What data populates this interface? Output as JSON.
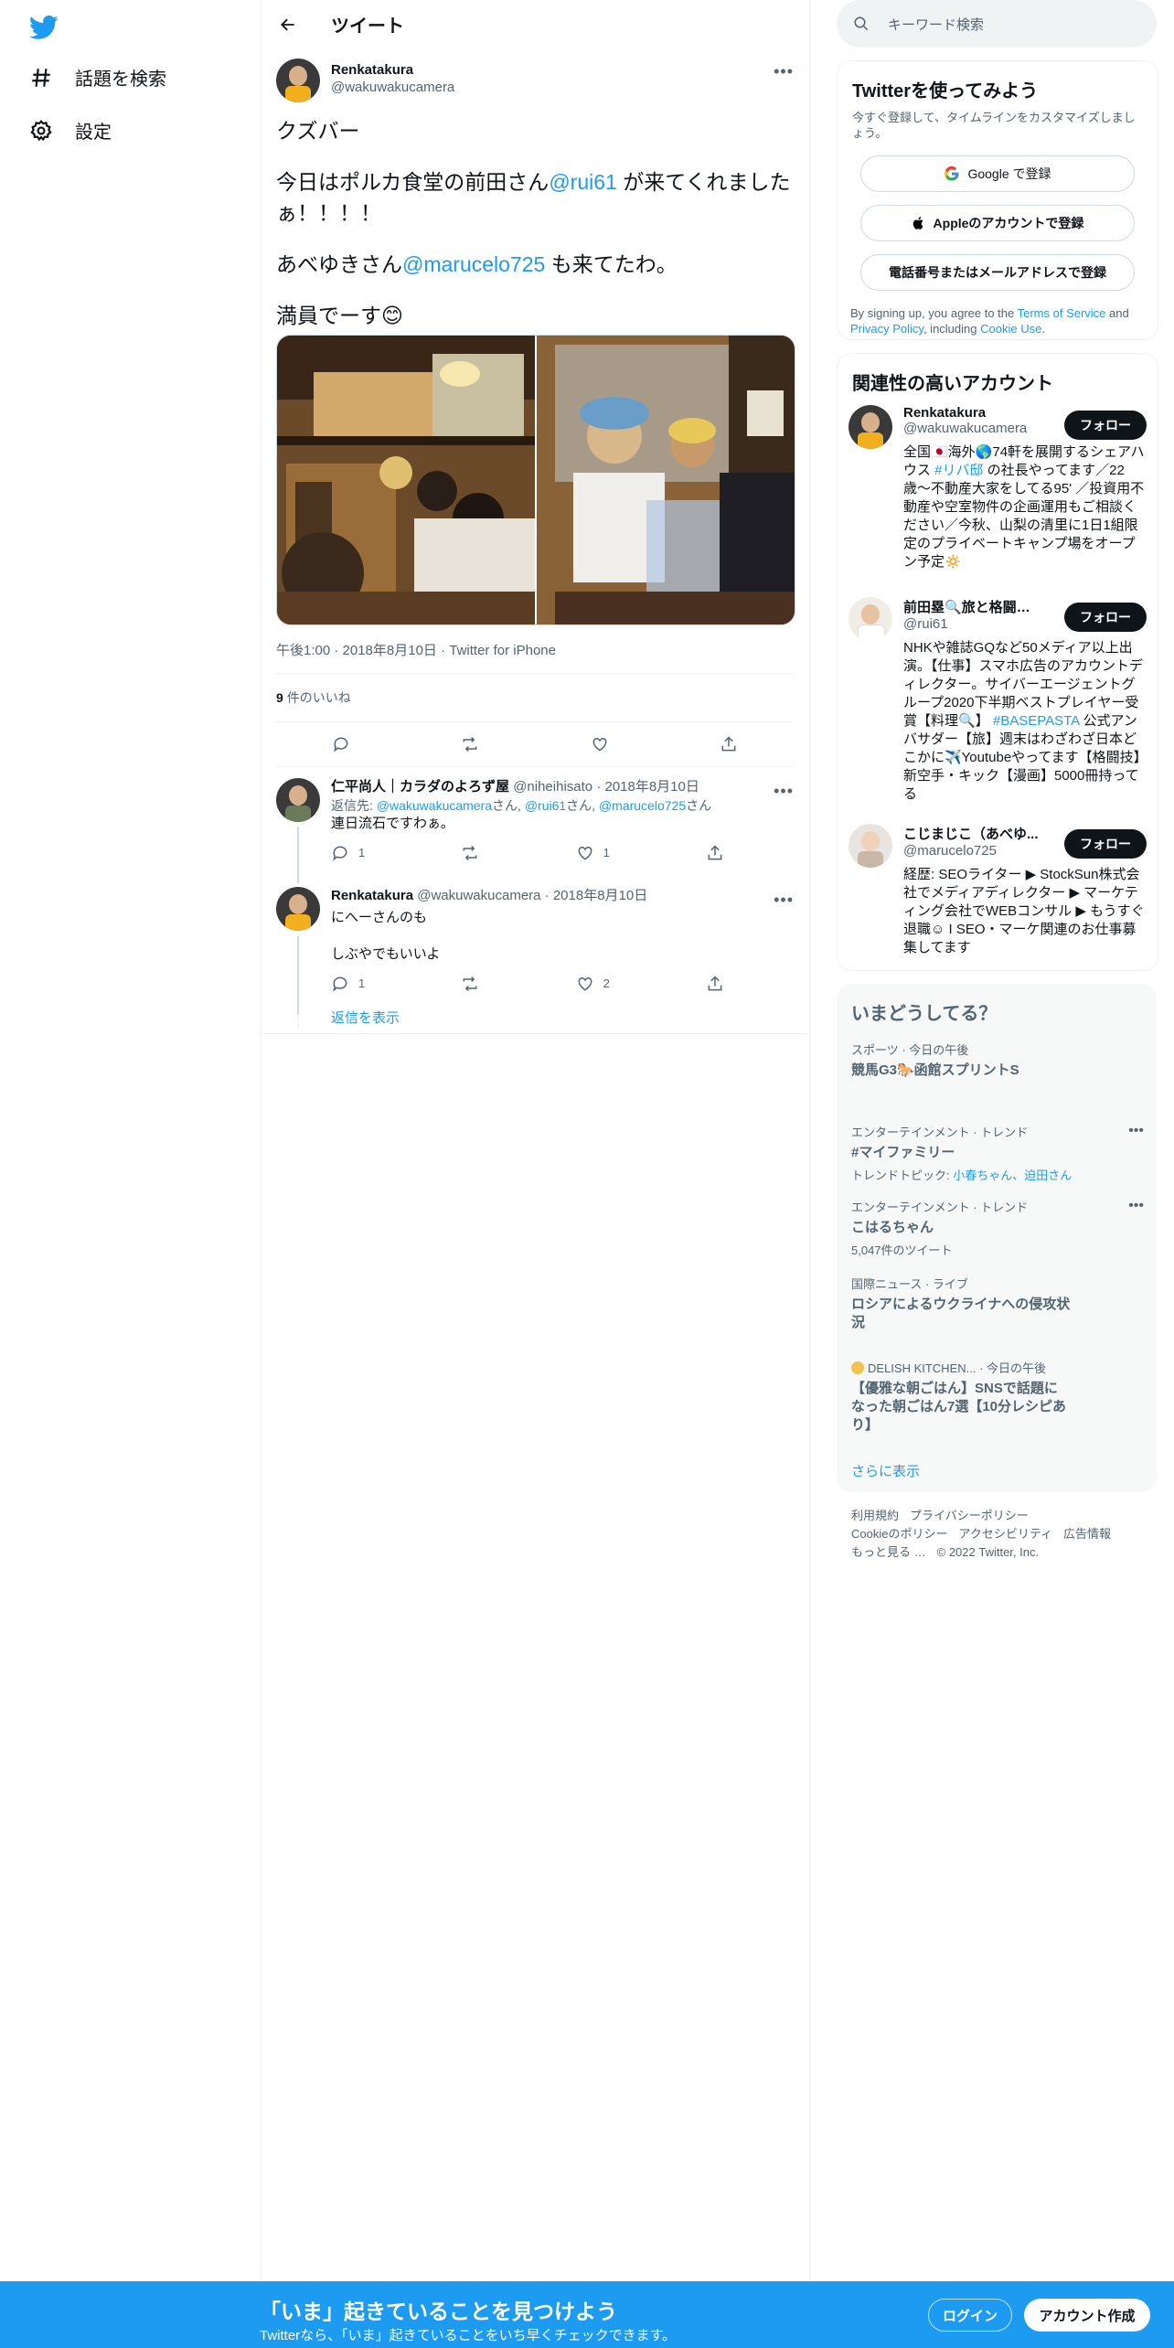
{
  "nav": {
    "explore_label": "話題を検索",
    "settings_label": "設定"
  },
  "header": {
    "title": "ツイート"
  },
  "tweet": {
    "name": "Renkatakura",
    "handle": "@wakuwakucamera",
    "line1": "クズバー",
    "line2_a": "今日はポルカ食堂の前田さん",
    "line2_mention": "@rui61",
    "line2_b": " が来てくれましたぁ！！！！",
    "line3_a": "あべゆきさん",
    "line3_mention": "@marucelo725",
    "line3_b": " も来てたわ。",
    "line4": "満員でーす😊",
    "meta": "午後1:00 · 2018年8月10日 · Twitter for iPhone",
    "likes_count": "9",
    "likes_label": "件のいいね"
  },
  "replies": [
    {
      "name": "仁平尚人｜カラダのよろず屋",
      "handle": "@niheihisato",
      "date": "· 2018年8月10日",
      "reply_to_label": "返信先: ",
      "reply_to_1": "@wakuwakucamera",
      "reply_to_2": "@rui61",
      "reply_to_3": "@marucelo725",
      "san": "さん",
      "text1": "連日流石ですわぁ。",
      "text2": "",
      "replies": "1",
      "likes": "1"
    },
    {
      "name": "Renkatakura",
      "handle": "@wakuwakucamera",
      "date": "· 2018年8月10日",
      "text1": "にへーさんのも",
      "text2": "しぶやでもいいよ",
      "replies": "1",
      "likes": "2"
    }
  ],
  "show_replies": "返信を表示",
  "search": {
    "placeholder": "キーワード検索"
  },
  "signup": {
    "title": "Twitterを使ってみよう",
    "subtitle": "今すぐ登録して、タイムラインをカスタマイズしましょう。",
    "google": "Google で登録",
    "apple": "Appleのアカウントで登録",
    "phone": "電話番号またはメールアドレスで登録",
    "legal_a": "By signing up, you agree to the ",
    "terms": "Terms of Service",
    "legal_and": " and ",
    "privacy": "Privacy Policy",
    "legal_b": ", including ",
    "cookie": "Cookie Use",
    "legal_end": "."
  },
  "relevant": {
    "title": "関連性の高いアカウント",
    "follow_label": "フォロー",
    "accounts": [
      {
        "name": "Renkatakura",
        "handle": "@wakuwakucamera",
        "bio_a": "全国🇯🇵海外🌎74軒を展開するシェアハウス ",
        "bio_tag": "#リバ邸",
        "bio_b": " の社長やってます／22歳〜不動産大家をしてる95' ／投資用不動産や空室物件の企画運用もご相談ください／今秋、山梨の清里に1日1組限定のプライベートキャンプ場をオープン予定🔅"
      },
      {
        "name": "前田塁🔍旅と格闘技...",
        "handle": "@rui61",
        "bio_a": "NHKや雑誌GQなど50メディア以上出演。【仕事】スマホ広告のアカウントディレクター。サイバーエージェントグループ2020下半期ベストプレイヤー受賞【料理🔍】",
        "bio_tag": "#BASEPASTA",
        "bio_b": " 公式アンバサダー【旅】週末はわざわざ日本どこかに✈️Youtubeやってます【格闘技】新空手・キック【漫画】5000冊持ってる"
      },
      {
        "name": "こじまじこ（あべゆ...",
        "handle": "@marucelo725",
        "bio_a": "経歴: SEOライター ▶ StockSun株式会社でメディアディレクター ▶ マーケティング会社でWEBコンサル ▶ もうすぐ退職☺︎ I SEO・マーケ関連のお仕事募集してます",
        "bio_tag": "",
        "bio_b": ""
      }
    ]
  },
  "trends": {
    "title": "いまどうしてる？",
    "items": [
      {
        "category": "スポーツ · 今日の午後",
        "title": "競馬G3🐎函館スプリントS",
        "sub": ""
      },
      {
        "category": "エンターテインメント · トレンド",
        "title": "#マイファミリー",
        "sub_label": "トレンドトピック: ",
        "sub": "小春ちゃん、迫田さん"
      },
      {
        "category": "エンターテインメント · トレンド",
        "title": "こはるちゃん",
        "sub": "5,047件のツイート"
      },
      {
        "category": "国際ニュース · ライブ",
        "title": "ロシアによるウクライナへの侵攻状況",
        "sub": ""
      },
      {
        "category": "DELISH KITCHEN... · 今日の午後",
        "title": "【優雅な朝ごはん】SNSで話題になった朝ごはん7選【10分レシピあり】",
        "sub": ""
      }
    ],
    "show_more": "さらに表示"
  },
  "footer": {
    "terms": "利用規約",
    "privacy": "プライバシーポリシー",
    "cookie": "Cookieのポリシー",
    "accessibility": "アクセシビリティ",
    "ads": "広告情報",
    "more": "もっと見る …",
    "copyright": "© 2022 Twitter, Inc."
  },
  "bottom_bar": {
    "title": "「いま」起きていることを見つけよう",
    "subtitle": "Twitterなら、「いま」起きていることをいち早くチェックできます。",
    "login": "ログイン",
    "signup": "アカウント作成"
  },
  "colors": {
    "accent": "#1d9bf0",
    "text": "#0f1419",
    "muted": "#536471"
  }
}
